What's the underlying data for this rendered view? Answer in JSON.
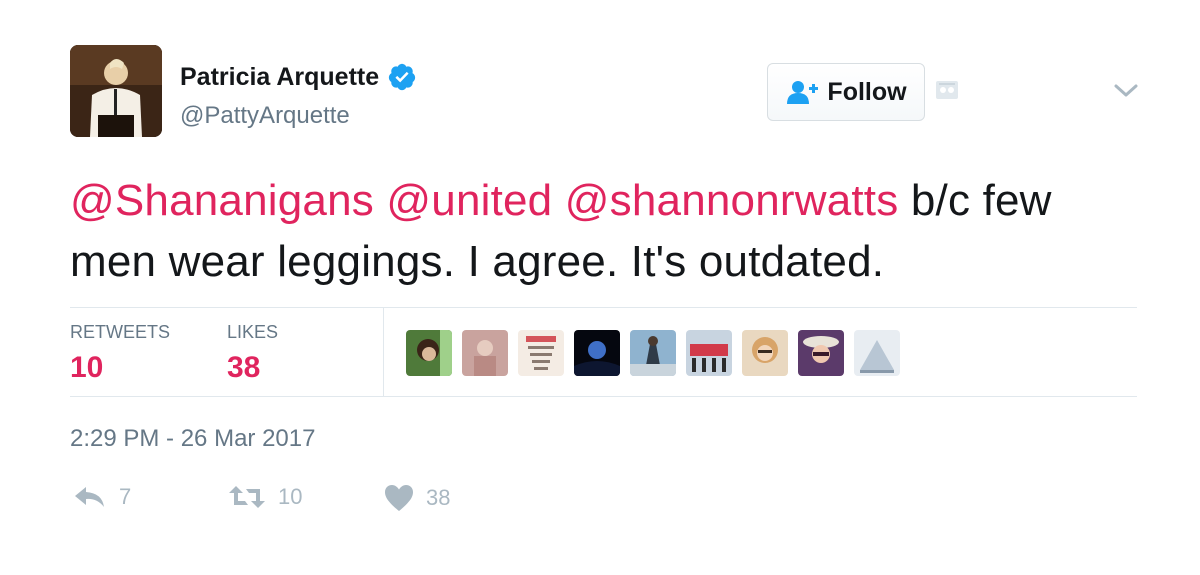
{
  "author": {
    "name": "Patricia Arquette",
    "handle": "@PattyArquette"
  },
  "follow_button": {
    "label": "Follow"
  },
  "tweet": {
    "mentions": [
      "@Shananigans",
      "@united",
      "@shannonrwatts"
    ],
    "text": " b/c few men wear leggings. I agree. It's outdated."
  },
  "stats": {
    "retweets_label": "RETWEETS",
    "retweets_value": "10",
    "likes_label": "LIKES",
    "likes_value": "38"
  },
  "timestamp": "2:29 PM - 26 Mar 2017",
  "actions": {
    "reply_count": "7",
    "retweet_count": "10",
    "like_count": "38"
  },
  "colors": {
    "accent": "#e0245e",
    "verified": "#1da1f2",
    "muted": "#657786",
    "icon_gray": "#aab8c2"
  },
  "icons": {
    "verified": "verified-badge-icon",
    "follow": "add-user-icon",
    "embed": "embed-icon",
    "menu": "chevron-down-icon",
    "reply": "reply-icon",
    "retweet": "retweet-icon",
    "like": "heart-icon"
  }
}
